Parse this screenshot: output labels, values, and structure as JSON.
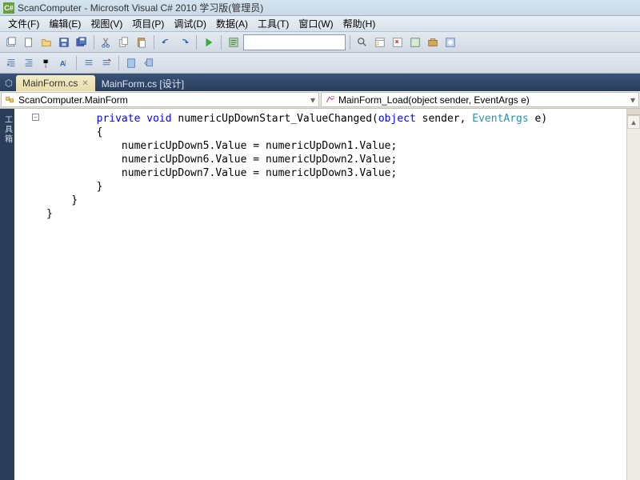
{
  "window": {
    "title": "ScanComputer - Microsoft Visual C# 2010 学习版(管理员)"
  },
  "menu": {
    "file": "文件(F)",
    "edit": "编辑(E)",
    "view": "视图(V)",
    "project": "项目(P)",
    "debug": "调试(D)",
    "data": "数据(A)",
    "tools": "工具(T)",
    "window": "窗口(W)",
    "help": "帮助(H)"
  },
  "tabs": {
    "active": "MainForm.cs",
    "inactive": "MainForm.cs [设计]"
  },
  "nav": {
    "class": "ScanComputer.MainForm",
    "method": "MainForm_Load(object sender, EventArgs e)"
  },
  "side": {
    "toolbox": "工具箱"
  },
  "code": {
    "l1a": "private",
    "l1b": "void",
    "l1c": " numericUpDownStart_ValueChanged(",
    "l1d": "object",
    "l1e": " sender, ",
    "l1f": "EventArgs",
    "l1g": " e)",
    "l2": "{",
    "l3": "    numericUpDown5.Value = numericUpDown1.Value;",
    "l4": "    numericUpDown6.Value = numericUpDown2.Value;",
    "l5": "    numericUpDown7.Value = numericUpDown3.Value;",
    "l6": "}",
    "l7": "    }",
    "l8": "}"
  }
}
